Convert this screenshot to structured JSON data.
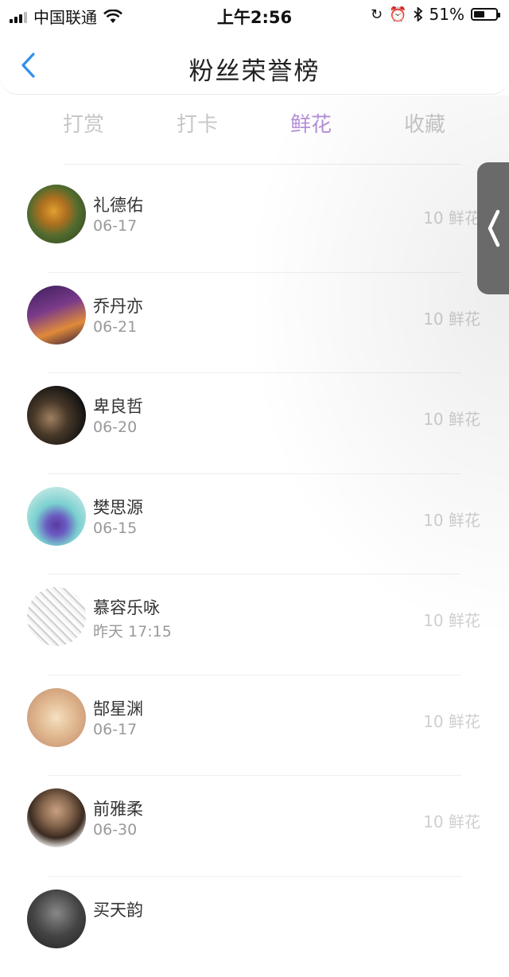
{
  "status_bar": {
    "carrier": "中国联通",
    "time": "上午2:56",
    "battery_percent": "51%",
    "battery_level": 0.51
  },
  "header": {
    "title": "粉丝荣誉榜"
  },
  "tabs": [
    {
      "label": "打赏",
      "active": false
    },
    {
      "label": "打卡",
      "active": false
    },
    {
      "label": "鲜花",
      "active": true
    },
    {
      "label": "收藏",
      "active": false
    }
  ],
  "fans": [
    {
      "name": "礼德佑",
      "date": "06-17",
      "count": "10 鲜花"
    },
    {
      "name": "乔丹亦",
      "date": "06-21",
      "count": "10 鲜花"
    },
    {
      "name": "卑良哲",
      "date": "06-20",
      "count": "10 鲜花"
    },
    {
      "name": "樊思源",
      "date": "06-15",
      "count": "10 鲜花"
    },
    {
      "name": "慕容乐咏",
      "date": "昨天 17:15",
      "count": "10 鲜花"
    },
    {
      "name": "郜星渊",
      "date": "06-17",
      "count": "10 鲜花"
    },
    {
      "name": "前雅柔",
      "date": "06-30",
      "count": "10 鲜花"
    },
    {
      "name": "买天韵",
      "date": "",
      "count": ""
    }
  ],
  "colors": {
    "active_tab": "#b58fd8",
    "inactive_tab": "#c7c7c7",
    "back_arrow": "#2f8ff0"
  }
}
